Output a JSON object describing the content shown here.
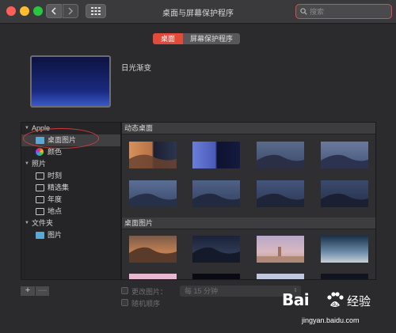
{
  "window": {
    "title": "桌面与屏幕保护程序"
  },
  "toolbar": {
    "search_placeholder": "搜索",
    "back_icon": "chevron-left-icon",
    "forward_icon": "chevron-right-icon",
    "grid_icon": "grid-icon",
    "search_icon": "magnifier-icon"
  },
  "tabs": [
    {
      "label": "桌面",
      "active": true
    },
    {
      "label": "屏幕保护程序",
      "active": false
    }
  ],
  "preview": {
    "name": "日光渐变"
  },
  "sidebar": {
    "groups": [
      {
        "label": "Apple",
        "expanded": true,
        "items": [
          {
            "label": "桌面图片",
            "icon": "folder-icon",
            "selected": true
          },
          {
            "label": "颜色",
            "icon": "color-wheel-icon",
            "selected": false
          }
        ]
      },
      {
        "label": "照片",
        "expanded": true,
        "items": [
          {
            "label": "时刻",
            "icon": "folder-icon"
          },
          {
            "label": "精选集",
            "icon": "folder-icon"
          },
          {
            "label": "年度",
            "icon": "folder-icon"
          },
          {
            "label": "地点",
            "icon": "folder-icon"
          }
        ]
      },
      {
        "label": "文件夹",
        "expanded": true,
        "items": [
          {
            "label": "图片",
            "icon": "folder-icon"
          }
        ]
      }
    ]
  },
  "content": {
    "sections": [
      {
        "header": "动态桌面"
      },
      {
        "header": "桌面图片"
      }
    ]
  },
  "controls": {
    "add_label": "+",
    "remove_label": "—",
    "change_picture_label": "更改图片：",
    "interval_value": "每 15 分钟",
    "random_order_label": "随机顺序"
  },
  "watermark": {
    "brand": "Bai",
    "brand_tail": "经验",
    "url": "jingyan.baidu.com"
  },
  "colors": {
    "accent": "#e34a3a",
    "annotation": "#d23b3b",
    "window_bg": "#2b2b2d"
  }
}
